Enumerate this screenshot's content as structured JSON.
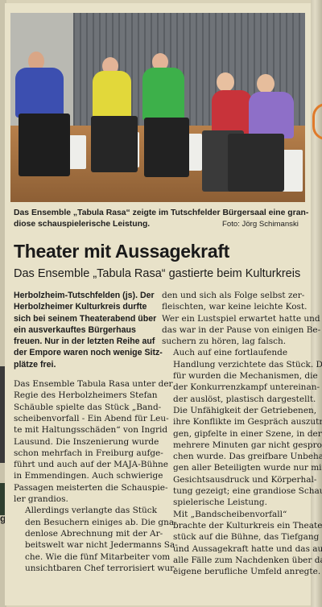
{
  "caption": "Das Ensemble „Tabula Rasa“ zeigte im Tutschfelder Bürgersaal eine grandiose schauspielerische Leistung.",
  "caption_lines": [
    "Das Ensemble „Tabula Rasa“ zeigte im Tutschfelder Bürgersaal eine gran-",
    "diose schauspielerische Leistung."
  ],
  "photo_credit": "Foto: Jörg Schimanski",
  "headline": "Theater mit Aussagekraft",
  "subheadline": "Das Ensemble „Tabula Rasa“ gastierte beim Kulturkreis",
  "left_column": {
    "lead_lines": [
      "Herbolzheim-Tutschfelden (js). Der",
      "Herbolzheimer Kulturkreis durfte",
      "sich bei seinem Theaterabend über",
      "ein ausverkauftes Bürgerhaus",
      "freuen. Nur in der letzten Reihe auf",
      "der Empore waren noch wenige Sitz-",
      "plätze frei."
    ],
    "para1_lines": [
      "Das Ensemble Tabula Rasa unter der",
      "Regie des Herbolzheimers Stefan",
      "Schäuble spielte das Stück „Band-",
      "scheibenvorfall - Ein Abend für Leu-",
      "te mit Haltungsschäden“ von Ingrid",
      "Lausund. Die Inszenierung wurde",
      "schon mehrfach in Freiburg aufge-",
      "führt und auch auf der MAJA-Bühne",
      "in Emmendingen. Auch schwierige",
      "Passagen meisterten die Schauspie-",
      "ler grandios."
    ],
    "para2_lines": [
      "Allerdings verlangte das Stück",
      "den Besuchern einiges ab. Die gna-",
      "denlose Abrechnung mit der Ar-",
      "beitswelt war nicht Jedermanns Sa-",
      "che. Wie die fünf Mitarbeiter vom",
      "unsichtbaren Chef terrorisiert wur-"
    ]
  },
  "right_column": {
    "para1_lines": [
      "den und sich als Folge selbst zer-",
      "fleischten, war keine leichte Kost.",
      "Wer ein Lustspiel erwartet hatte und",
      "das war in der Pause von einigen Be-",
      "suchern zu hören, lag falsch."
    ],
    "para2_lines": [
      "Auch auf eine fortlaufende",
      "Handlung verzichtete das Stück. Da-",
      "für wurden die Mechanismen, die",
      "der Konkurrenzkampf untereinan-",
      "der auslöst, plastisch dargestellt.",
      "Die Unfähigkeit der Getriebenen,",
      "ihre Konflikte im Gespräch auszutra-",
      "gen, gipfelte in einer Szene, in der",
      "mehrere Minuten gar nicht gespro-",
      "chen wurde. Das greifbare Unbeha-",
      "gen aller Beteiligten wurde nur mit",
      "Gesichtsausdruck und Körperhal-",
      "tung gezeigt; eine grandiose Schau-",
      "spielerische Leistung."
    ],
    "para3_lines": [
      "Mit „Bandscheibenvorfall“",
      "brachte der Kulturkreis ein Theater-",
      "stück auf die Bühne, das Tiefgang",
      "und Aussagekraft hatte und das auf",
      "alle Fälle zum Nachdenken über das",
      "eigene berufliche Umfeld anregte."
    ]
  },
  "margin_letter": "g"
}
